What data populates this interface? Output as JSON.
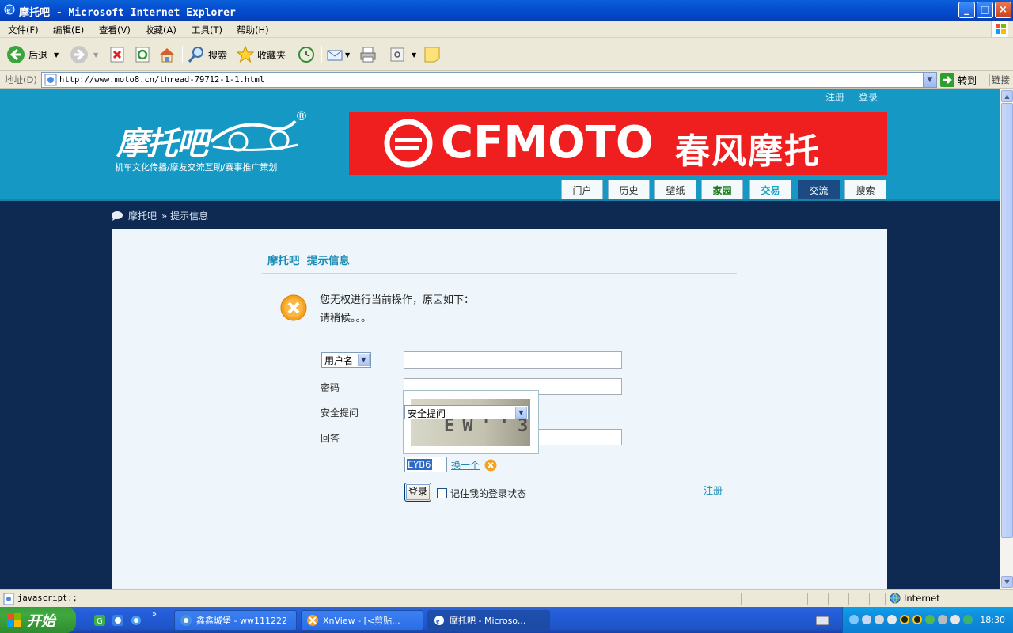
{
  "window": {
    "title": "摩托吧 - Microsoft Internet Explorer",
    "controls": [
      "_",
      "□",
      "×"
    ]
  },
  "menu": [
    "文件(F)",
    "编辑(E)",
    "查看(V)",
    "收藏(A)",
    "工具(T)",
    "帮助(H)"
  ],
  "toolbar": {
    "back": "后退",
    "search": "搜索",
    "favorites": "收藏夹"
  },
  "address": {
    "label": "地址(D)",
    "url": "http://www.moto8.cn/thread-79712-1-1.html",
    "go": "转到",
    "links": "链接"
  },
  "site": {
    "top_links": [
      "注册",
      "登录"
    ],
    "logo_text": "摩托吧",
    "logo_reg": "®",
    "slogan": "机车文化传播/摩友交流互助/赛事推广策划",
    "banner_brand": "CFMOTO",
    "banner_brand_cn": "春风摩托",
    "nav": [
      "门户",
      "历史",
      "壁纸",
      "家园",
      "交易",
      "交流",
      "搜索"
    ],
    "breadcrumb": [
      "摩托吧",
      "» 提示信息"
    ]
  },
  "panel": {
    "title_site": "摩托吧",
    "title_msg": "提示信息",
    "message_line1": "您无权进行当前操作，原因如下：",
    "message_line2": "请稍候。。。",
    "username_select": "用户名",
    "password_label": "密码",
    "question_label": "安全提问",
    "question_select": "安全提问",
    "answer_label": "回答",
    "captcha_value": "EYB6",
    "captcha_chars": "EW''3",
    "captcha_refresh": "换一个",
    "login_button": "登录",
    "remember_label": "记住我的登录状态",
    "register_link": "注册"
  },
  "status": {
    "text": "javascript:;",
    "zone": "Internet"
  },
  "taskbar": {
    "start": "开始",
    "tasks": [
      "鑫鑫城堡 - ww111222",
      "XnView - [<剪贴...",
      "摩托吧 - Microso..."
    ],
    "clock": "18:30"
  }
}
